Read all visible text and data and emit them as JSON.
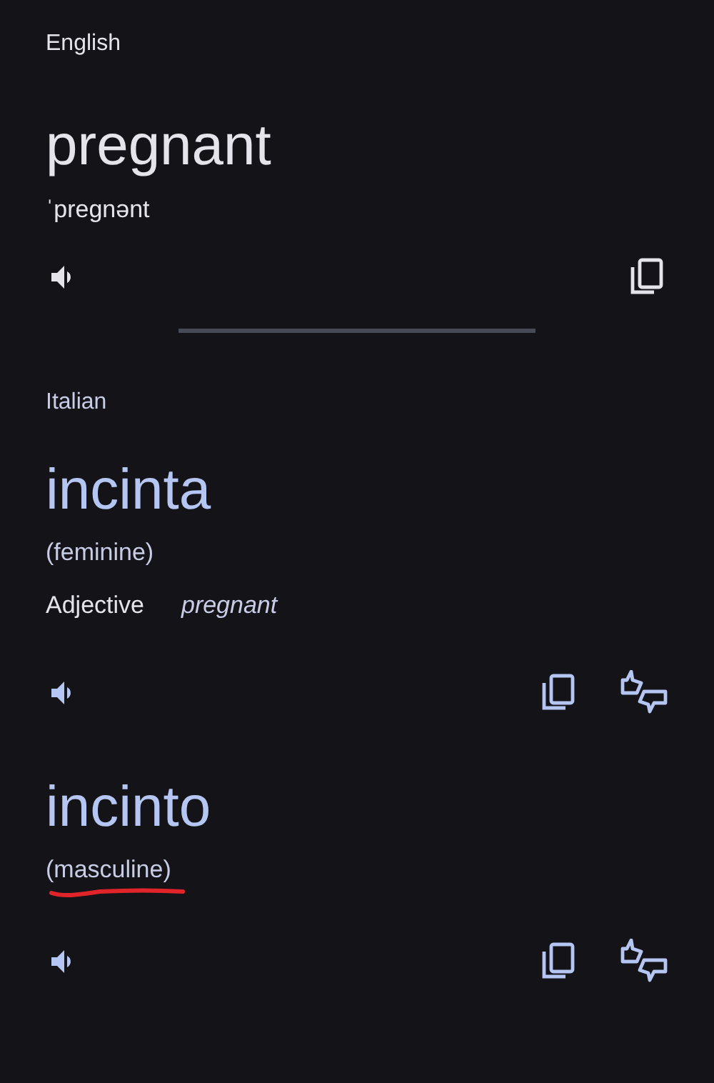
{
  "source": {
    "language": "English",
    "word": "pregnant",
    "phonetic": "ˈpregnənt"
  },
  "target": {
    "language": "Italian",
    "translations": [
      {
        "word": "incinta",
        "gender": "(feminine)",
        "underlined": false,
        "part_of_speech": "Adjective",
        "meaning": "pregnant"
      },
      {
        "word": "incinto",
        "gender": "(masculine)",
        "underlined": true
      }
    ]
  }
}
